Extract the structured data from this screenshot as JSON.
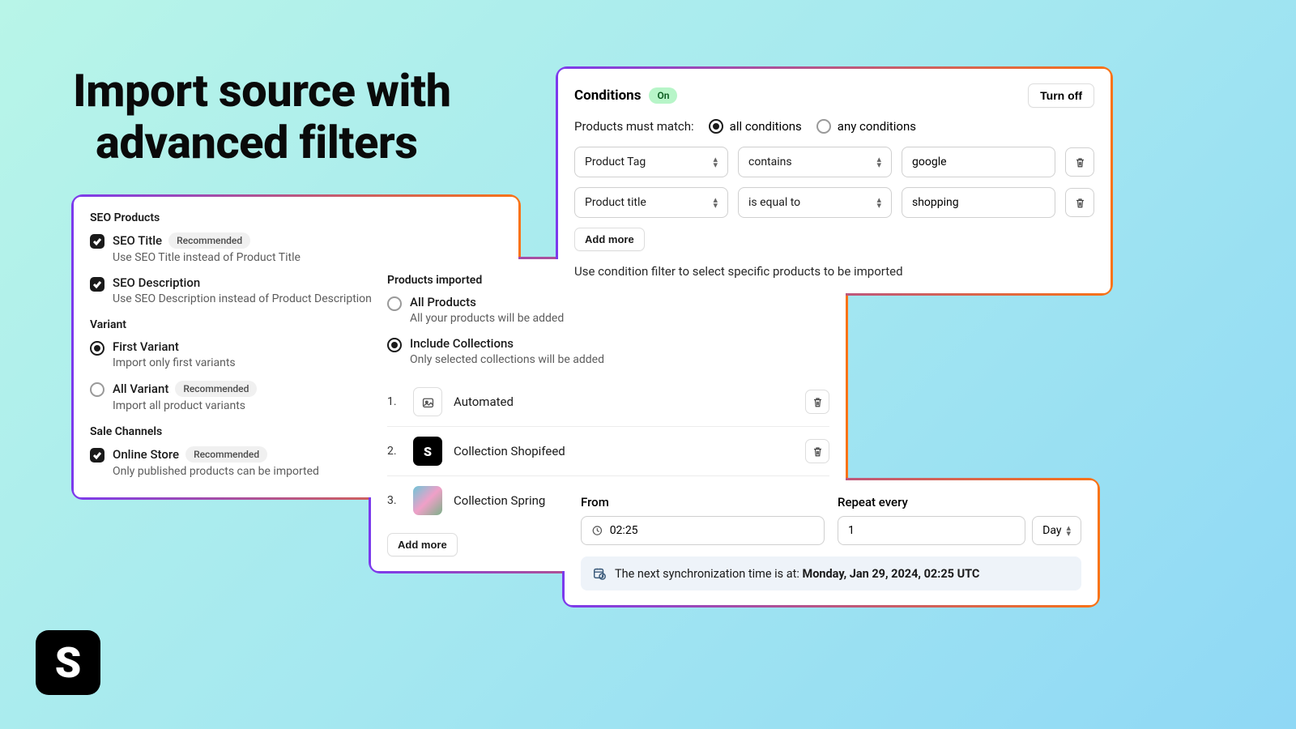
{
  "hero": {
    "line1": "Import source with",
    "line2": "advanced filters"
  },
  "seo_panel": {
    "section1_title": "SEO Products",
    "seo_title_label": "SEO Title",
    "seo_title_badge": "Recommended",
    "seo_title_desc": "Use SEO Title instead of Product Title",
    "seo_desc_label": "SEO Description",
    "seo_desc_desc": "Use SEO Description instead of Product Description",
    "section2_title": "Variant",
    "first_variant_label": "First Variant",
    "first_variant_desc": "Import only first variants",
    "all_variant_label": "All Variant",
    "all_variant_badge": "Recommended",
    "all_variant_desc": "Import all product variants",
    "section3_title": "Sale Channels",
    "online_store_label": "Online Store",
    "online_store_badge": "Recommended",
    "online_store_desc": "Only published products can be imported"
  },
  "imported_panel": {
    "title": "Products imported",
    "all_label": "All Products",
    "all_desc": "All your products will be added",
    "include_label": "Include Collections",
    "include_desc": "Only selected collections will be added",
    "items": [
      {
        "idx": "1.",
        "name": "Automated"
      },
      {
        "idx": "2.",
        "name": "Collection Shopifeed"
      },
      {
        "idx": "3.",
        "name": "Collection Spring"
      }
    ],
    "add_more": "Add more"
  },
  "conditions_panel": {
    "title": "Conditions",
    "status": "On",
    "turn_off": "Turn off",
    "match_label": "Products must match:",
    "opt_all": "all conditions",
    "opt_any": "any conditions",
    "rows": [
      {
        "field": "Product Tag",
        "op": "contains",
        "value": "google"
      },
      {
        "field": "Product title",
        "op": "is equal to",
        "value": "shopping"
      }
    ],
    "add_more": "Add more",
    "note": "Use condition filter to select specific products to be imported"
  },
  "schedule_panel": {
    "from_label": "From",
    "from_value": "02:25",
    "repeat_label": "Repeat every",
    "repeat_value": "1",
    "repeat_unit": "Day",
    "sync_prefix": "The next synchronization time is at: ",
    "sync_time": "Monday, Jan 29, 2024, 02:25 UTC"
  }
}
